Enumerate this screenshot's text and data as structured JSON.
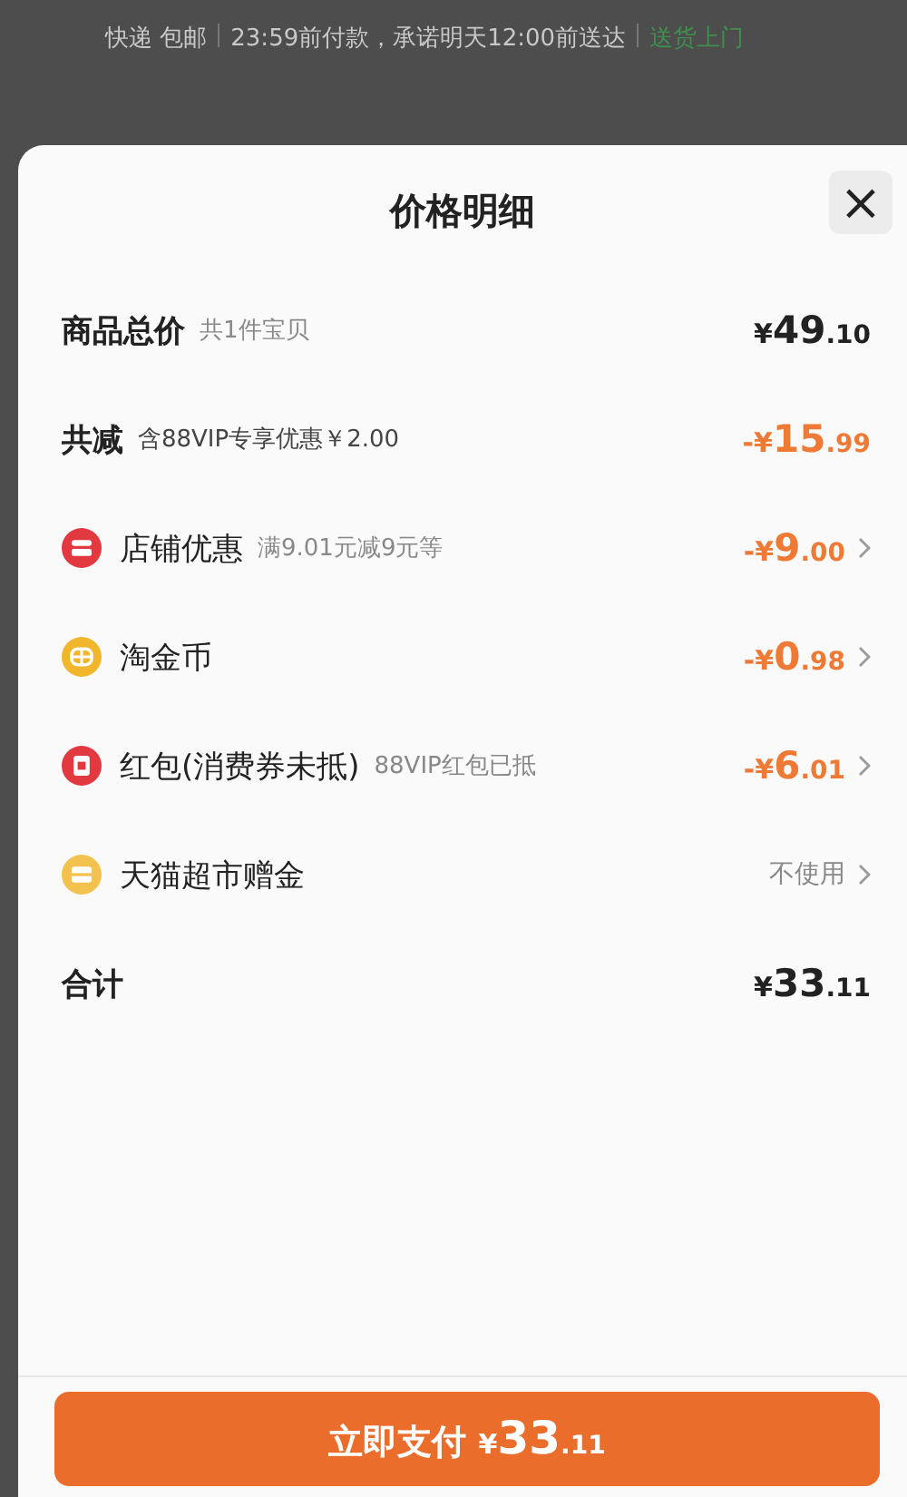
{
  "background": {
    "delivery": [
      {
        "text": "快递 包邮",
        "kind": "plain"
      },
      {
        "text": "23:59前付款，承诺明天12:00前送达",
        "kind": "plain"
      },
      {
        "text": "送货上门",
        "kind": "highlight"
      }
    ]
  },
  "sheet": {
    "title": "价格明细",
    "close": "×",
    "rows": [
      {
        "kind": "total",
        "name": "商品总价",
        "note": "共1件宝贝",
        "prefix": "¥",
        "integer": "49",
        "decimal": ".10",
        "chevron": false
      },
      {
        "kind": "discount",
        "name": "共减",
        "note": "含88VIP专享优惠￥2.00",
        "prefix": "-¥",
        "integer": "15",
        "decimal": ".99",
        "chevron": false
      },
      {
        "kind": "shop",
        "name": "店铺优惠",
        "note": "满9.01元减9元等",
        "prefix": "-¥",
        "integer": "9",
        "decimal": ".00",
        "chevron": true
      },
      {
        "kind": "coin",
        "name": "淘金币",
        "prefix": "-¥",
        "integer": "0",
        "decimal": ".98",
        "chevron": true
      },
      {
        "kind": "envelope",
        "name": "红包(消费券未抵)",
        "note": "88VIP红包已抵",
        "prefix": "-¥",
        "integer": "6",
        "decimal": ".01",
        "chevron": true
      },
      {
        "kind": "gift",
        "name": "天猫超市赠金",
        "value": "不使用",
        "chevron": true
      },
      {
        "kind": "sum",
        "name": "合计",
        "prefix": "¥",
        "integer": "33",
        "decimal": ".11",
        "chevron": false
      }
    ]
  },
  "pay_button": {
    "label": "立即支付",
    "prefix": "¥",
    "integer": "33",
    "decimal": ".11"
  }
}
